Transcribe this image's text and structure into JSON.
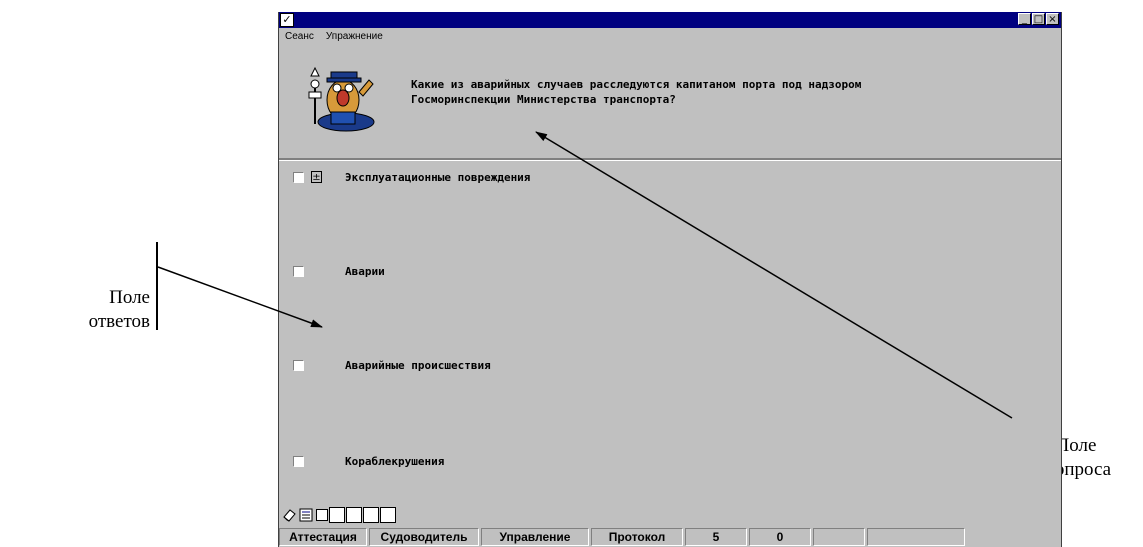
{
  "window": {
    "system_glyph": "✓",
    "title_buttons": [
      "_",
      "□",
      "×"
    ],
    "menu": [
      "Сеанс",
      "Упражнение"
    ]
  },
  "question": {
    "text": "Какие из аварийных случаев расследуются капитаном порта под надзором\nГосморинспекции Министерства транспорта?"
  },
  "answers": [
    {
      "label": "Эксплуатационные повреждения",
      "has_expand": true,
      "expand_glyph": "±"
    },
    {
      "label": "Аварии",
      "has_expand": false
    },
    {
      "label": "Аварийные происшествия",
      "has_expand": false
    },
    {
      "label": "Кораблекрушения",
      "has_expand": false
    }
  ],
  "statusbar": [
    "Аттестация",
    "Судоводитель",
    "Управление",
    "Протокол",
    "5",
    "0",
    "",
    ""
  ],
  "annotations": {
    "answers_field": "Поле\nответов",
    "question_field": "Поле\nвопроса"
  }
}
